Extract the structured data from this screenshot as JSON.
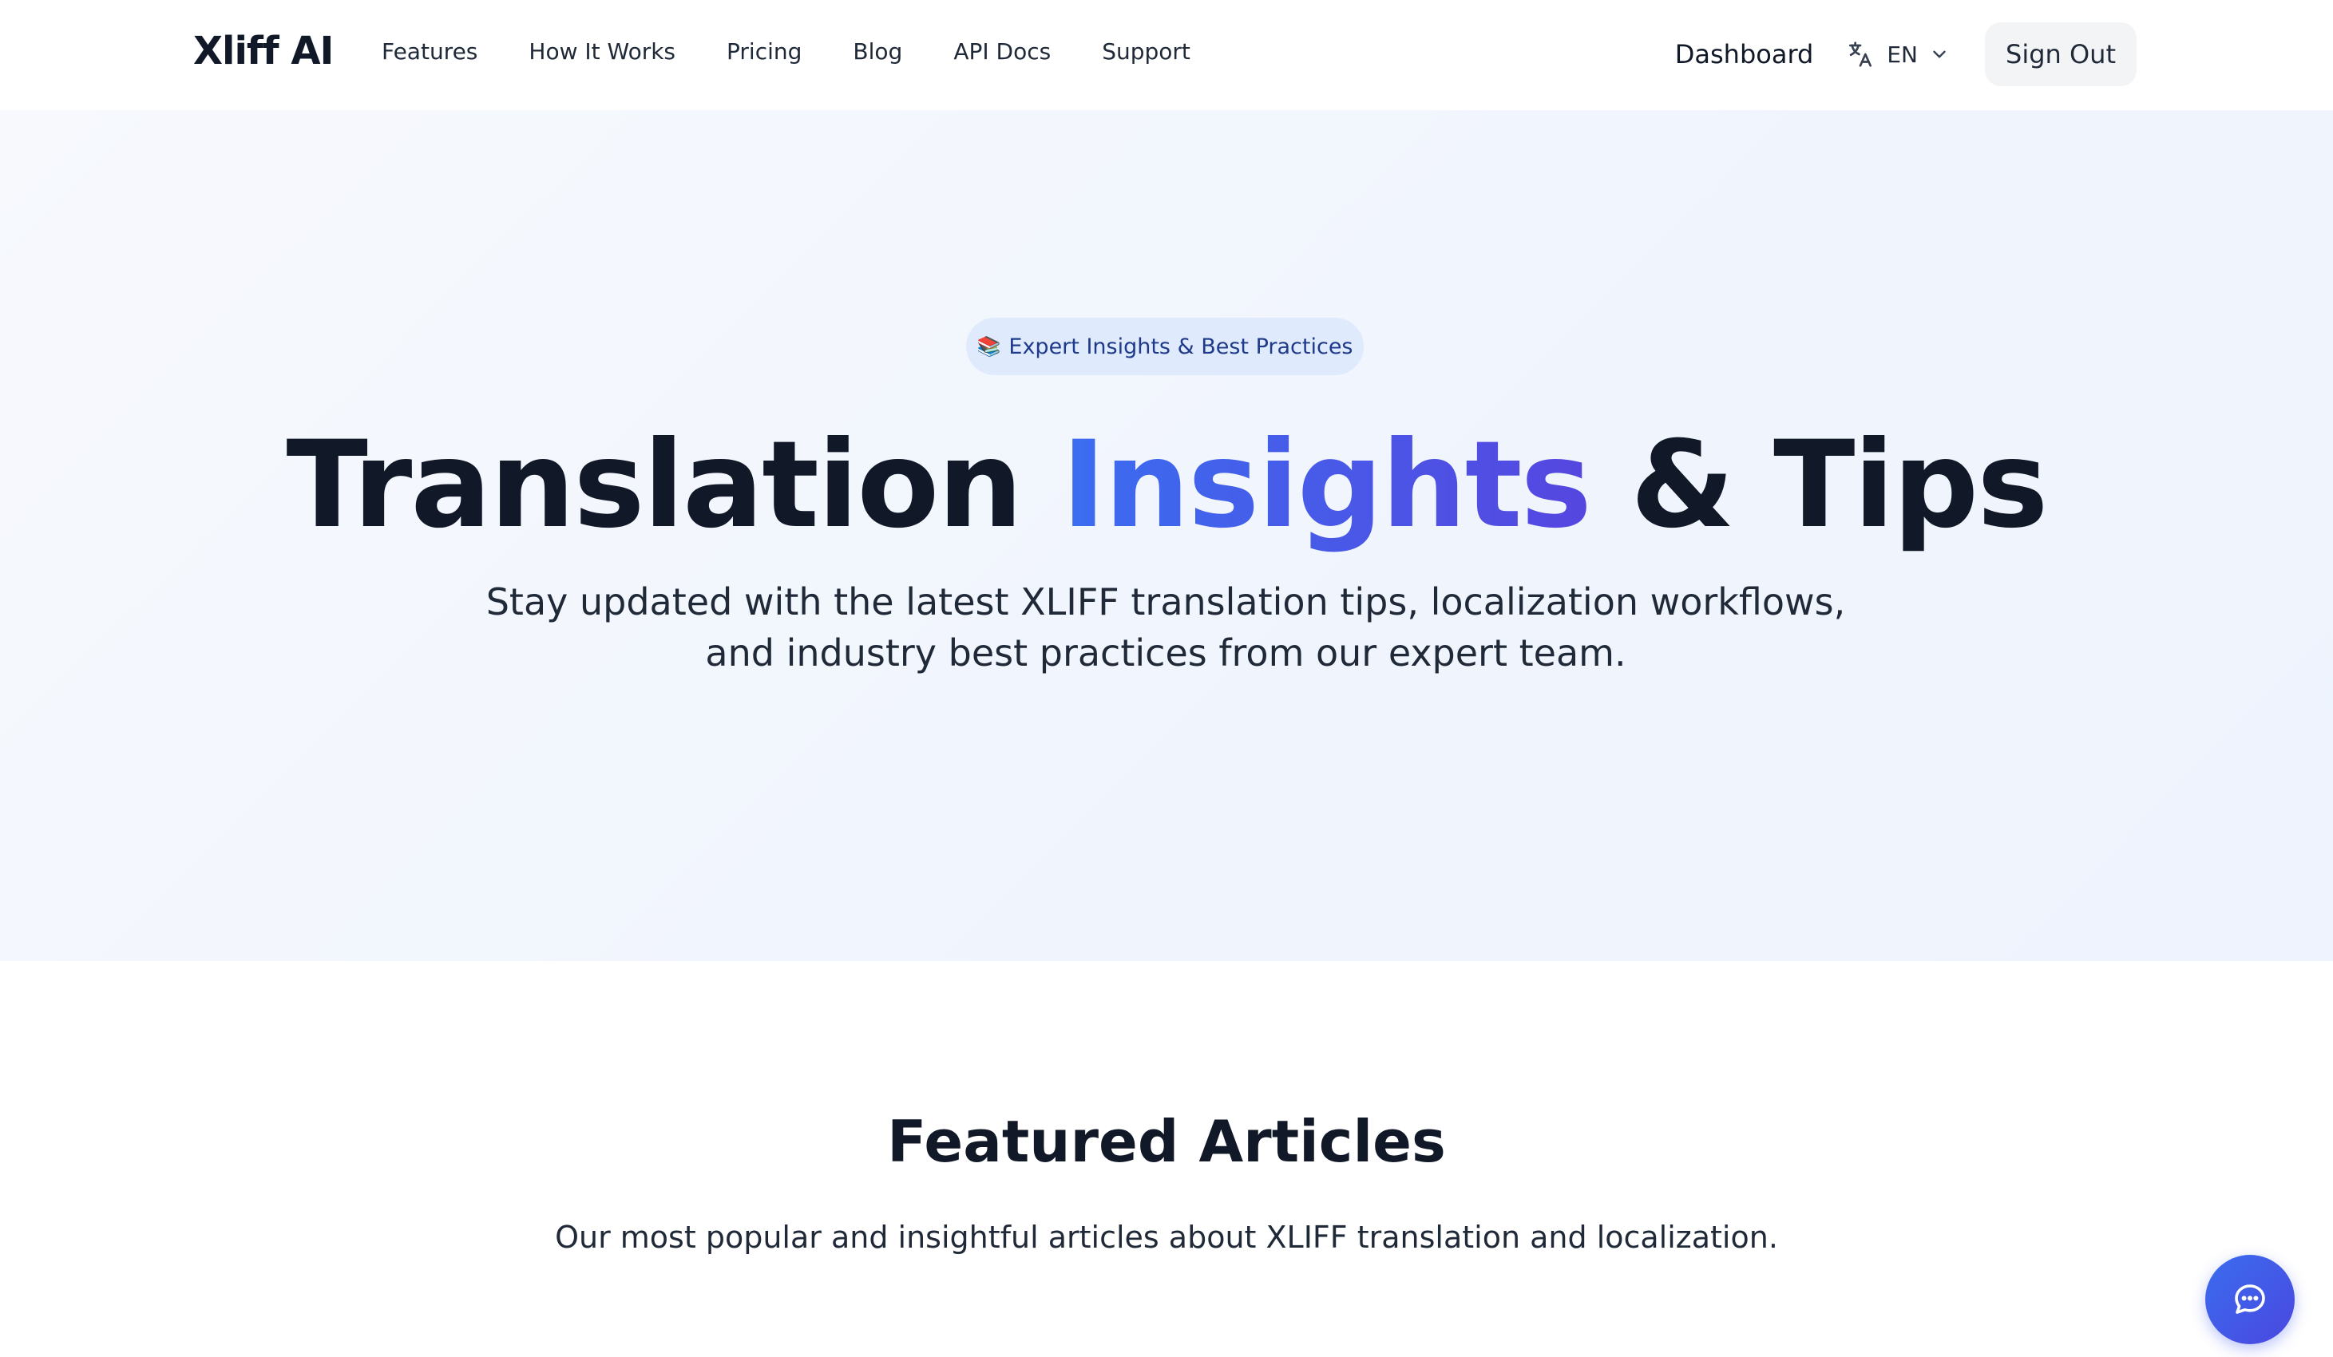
{
  "nav": {
    "brand": "Xliff AI",
    "links": [
      "Features",
      "How It Works",
      "Pricing",
      "Blog",
      "API Docs",
      "Support"
    ],
    "dashboard": "Dashboard",
    "language": {
      "icon": "translate-icon",
      "code": "EN"
    },
    "sign_out": "Sign Out"
  },
  "hero": {
    "badge_emoji": "📚",
    "badge_text": "Expert Insights & Best Practices",
    "title_part1": "Translation ",
    "title_accent": "Insights",
    "title_part2": " & Tips",
    "subtitle": "Stay updated with the latest XLIFF translation tips, localization workflows, and industry best practices from our expert team."
  },
  "featured": {
    "title": "Featured Articles",
    "subtitle": "Our most popular and insightful articles about XLIFF translation and localization."
  },
  "chat": {
    "icon": "chat-bubble-icon"
  },
  "colors": {
    "accent": "#3b6df0",
    "accent_end": "#5546e0",
    "text": "#111827"
  }
}
